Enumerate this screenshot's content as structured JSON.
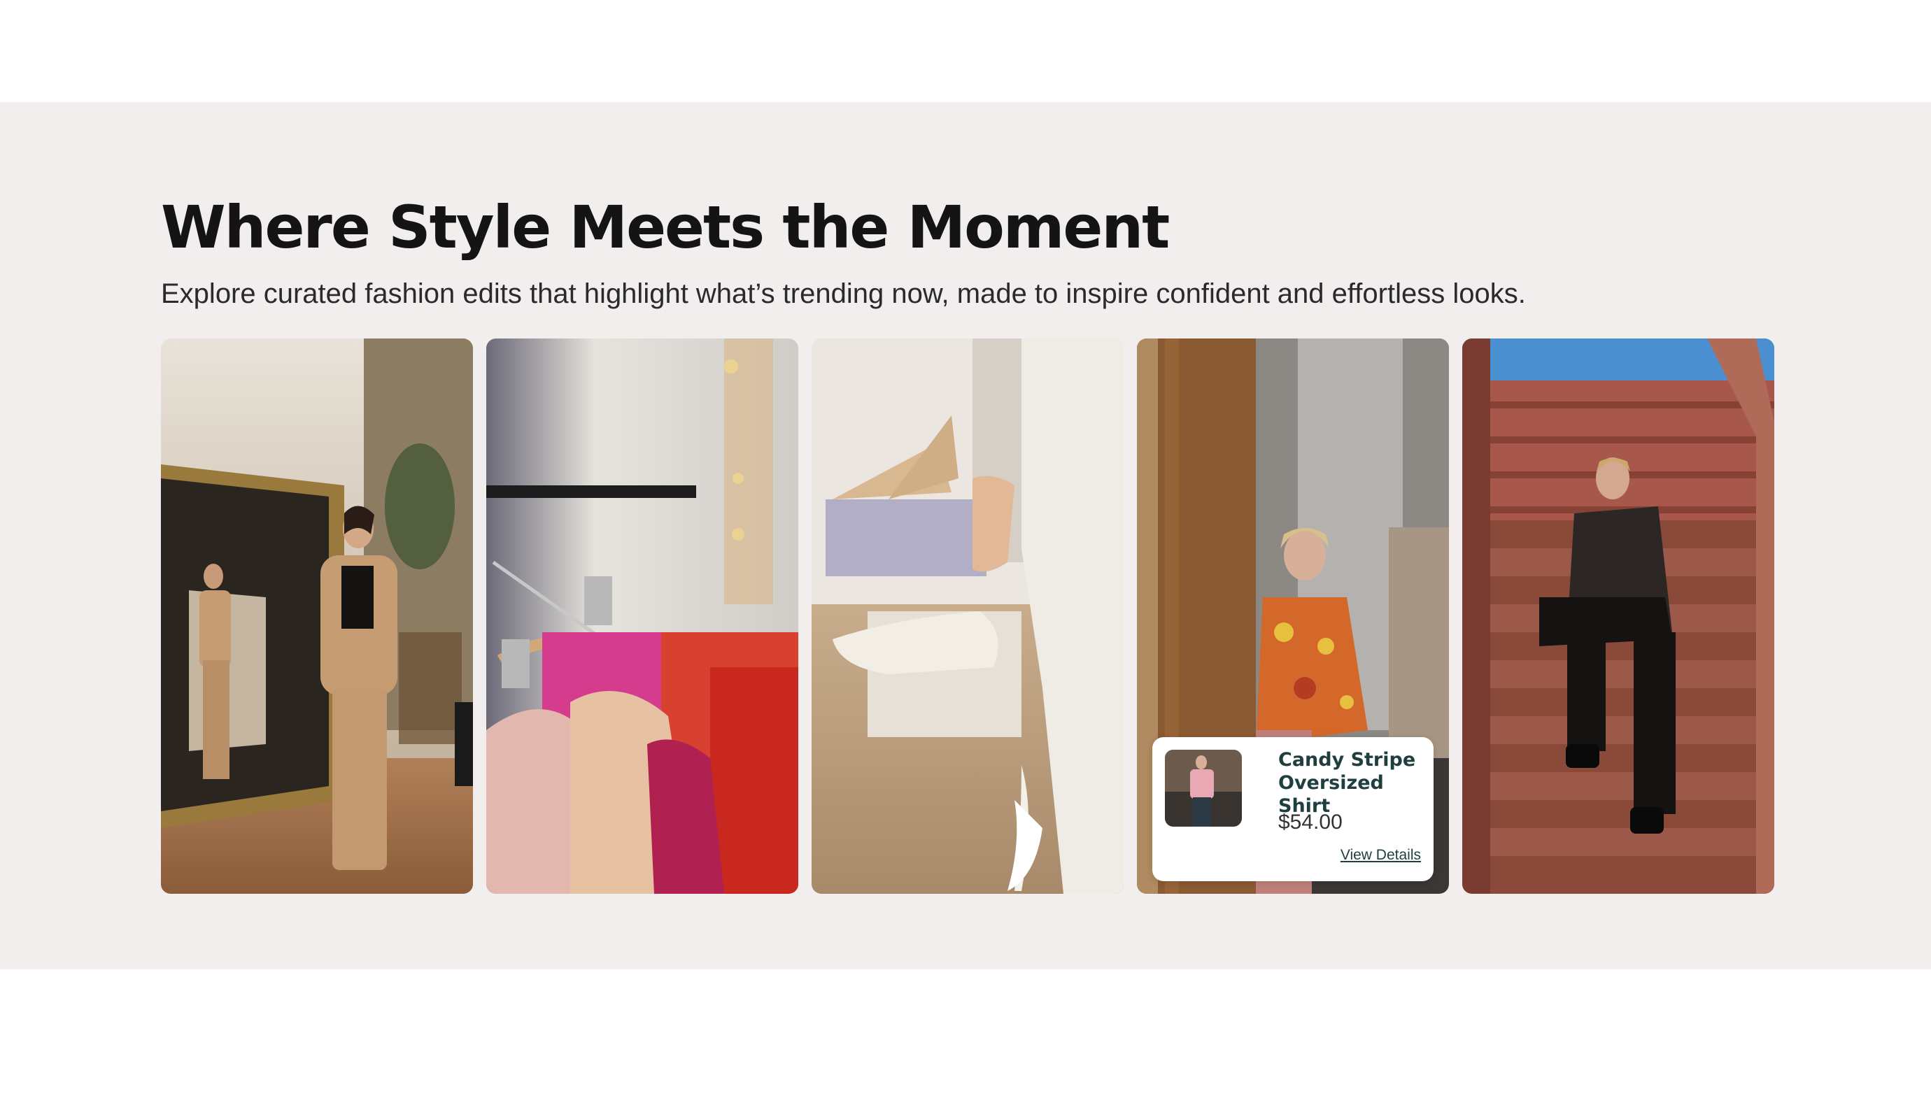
{
  "section": {
    "heading": "Where Style Meets the Moment",
    "subheading": "Explore curated fashion edits that highlight what’s trending now, made to inspire confident and effortless looks."
  },
  "gallery": {
    "cards": [
      {
        "image": "woman-in-beige-suit-mirror-photo"
      },
      {
        "image": "clothing-rack-with-hangers-photo"
      },
      {
        "image": "woman-trying-white-heels-photo"
      },
      {
        "image": "man-holding-patterned-shirt-store-photo"
      },
      {
        "image": "woman-on-brick-stairs-photo"
      }
    ],
    "product_popup": {
      "name": "Candy Stripe Oversized Shirt",
      "price": "$54.00",
      "link_label": "View Details",
      "thumbnail": "product-thumbnail-photo"
    }
  },
  "colors": {
    "section_background": "#f1eeed",
    "heading_text": "#141414",
    "product_text": "#1e3f3d"
  }
}
